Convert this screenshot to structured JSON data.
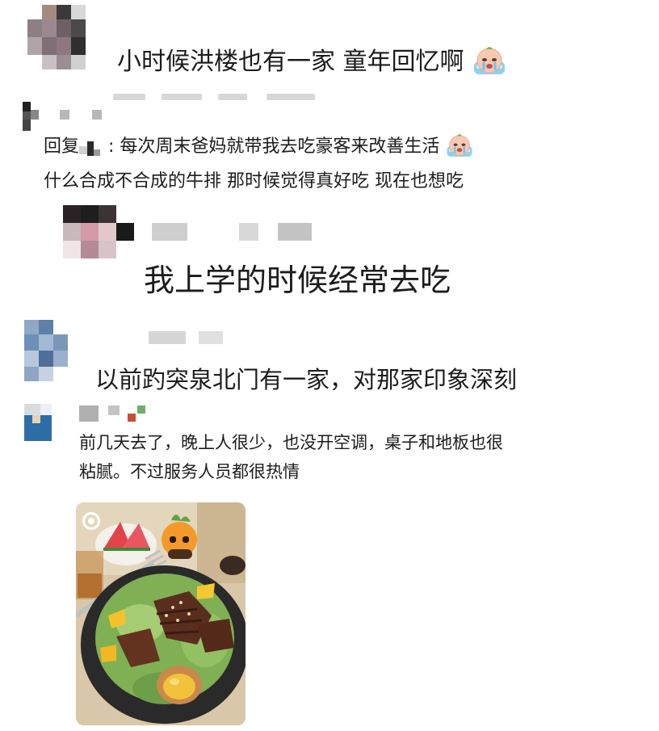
{
  "comments": [
    {
      "text": "小时候洪楼也有一家 童年回忆啊",
      "emoji": "crying-face-emoji"
    },
    {
      "reply_prefix": "回复",
      "reply_text": ": 每次周末爸妈就带我去吃豪客来改善生活",
      "reply_line2": "什么合成不合成的牛排 那时候觉得真好吃 现在也想吃",
      "emoji": "crying-face-emoji"
    },
    {
      "text": "我上学的时候经常去吃"
    },
    {
      "text": "以前趵突泉北门有一家，对那家印象深刻"
    },
    {
      "line1": "前几天去了，晚上人很少，也没开空调，桌子和地板也很",
      "line2": "粘腻。不过服务人员都很热情",
      "photo": "steak-salad-photo"
    }
  ],
  "colors": {
    "text": "#1c1c1c",
    "background": "#ffffff"
  }
}
